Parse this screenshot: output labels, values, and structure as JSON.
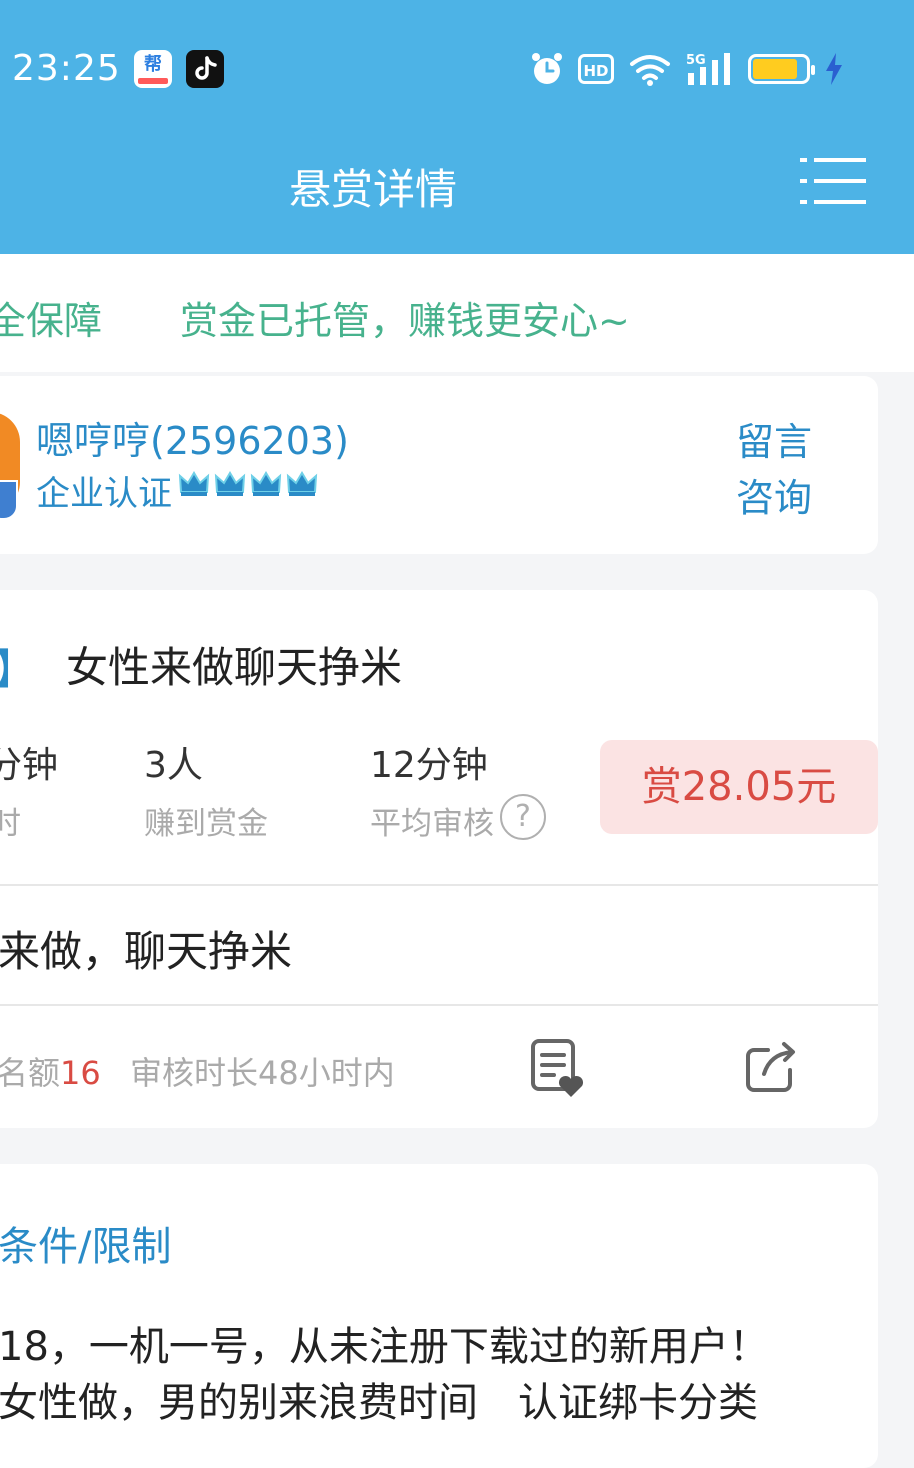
{
  "status_bar": {
    "time": "23:25",
    "bang_icon_glyph": "帮",
    "network_label": "5G",
    "hd_label": "HD",
    "icons": [
      "bang-app-icon",
      "tiktok-icon",
      "alarm-icon",
      "hd-icon",
      "wifi-icon",
      "signal-5g-icon",
      "battery-icon",
      "charging-icon"
    ],
    "battery_level": 0.85
  },
  "header": {
    "title": "悬赏详情",
    "menu_icon": "list-menu-icon",
    "background": "#4db3e6"
  },
  "notice": {
    "left_fragment": "全保障",
    "message": "赏金已托管，赚钱更安心~",
    "color": "#47b28d"
  },
  "publisher": {
    "name": "嗯哼哼(2596203)",
    "cert_label": "企业认证",
    "crown_count": 4,
    "consult_line1": "留言",
    "consult_line2": "咨询",
    "accent": "#2a8bc7"
  },
  "task": {
    "bracket": "】",
    "title": "女性来做聊天挣米",
    "stats": [
      {
        "value": "分钟",
        "label": "时"
      },
      {
        "value": "3人",
        "label": "赚到赏金"
      },
      {
        "value": "12分钟",
        "label": "平均审核"
      }
    ],
    "reward": "赏28.05元",
    "reward_color": "#d94b43",
    "description": "来做，聊天挣米",
    "quota_label": "名额",
    "quota_value": "16",
    "review_duration": "审核时长48小时内",
    "action_icons": [
      "favorite-list-icon",
      "share-icon"
    ]
  },
  "conditions": {
    "title": "条件/限制",
    "lines": [
      "18，一机一号，从未注册下载过的新用户！",
      "女性做，男的别来浪费时间　认证绑卡分类"
    ]
  }
}
